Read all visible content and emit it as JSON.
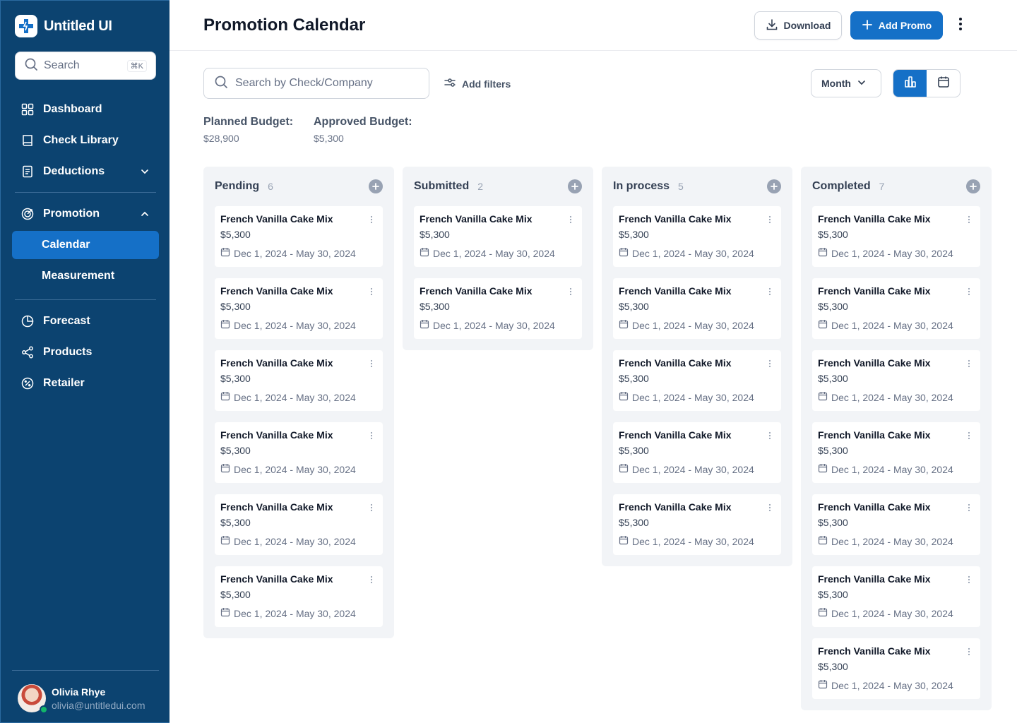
{
  "app": {
    "name": "Untitled UI"
  },
  "sidebar": {
    "search_placeholder": "Search",
    "search_shortcut": "⌘K",
    "items": [
      {
        "label": "Dashboard",
        "icon": "grid-icon"
      },
      {
        "label": "Check Library",
        "icon": "book-icon"
      },
      {
        "label": "Deductions",
        "icon": "receipt-icon"
      },
      {
        "label": "Promotion",
        "icon": "target-icon"
      },
      {
        "label": "Calendar"
      },
      {
        "label": "Measurement"
      },
      {
        "label": "Forecast",
        "icon": "pie-chart-icon"
      },
      {
        "label": "Products",
        "icon": "share-icon"
      },
      {
        "label": "Retailer",
        "icon": "percent-badge-icon"
      }
    ],
    "active_item": "Calendar"
  },
  "user": {
    "name": "Olivia Rhye",
    "email": "olivia@untitledui.com"
  },
  "header": {
    "title": "Promotion Calendar",
    "download_label": "Download",
    "add_label": "Add Promo"
  },
  "toolbar": {
    "search_placeholder": "Search by Check/Company",
    "filters_label": "Add filters",
    "period": "Month"
  },
  "budget": {
    "planned_label": "Planned Budget:",
    "planned_value": "$28,900",
    "approved_label": "Approved Budget:",
    "approved_value": "$5,300"
  },
  "board": {
    "columns": [
      {
        "title": "Pending",
        "count": "6",
        "cards": [
          {
            "title": "French Vanilla Cake Mix",
            "amount": "$5,300",
            "dates": "Dec 1, 2024 - May 30, 2024"
          },
          {
            "title": "French Vanilla Cake Mix",
            "amount": "$5,300",
            "dates": "Dec 1, 2024 - May 30, 2024"
          },
          {
            "title": "French Vanilla Cake Mix",
            "amount": "$5,300",
            "dates": "Dec 1, 2024 - May 30, 2024"
          },
          {
            "title": "French Vanilla Cake Mix",
            "amount": "$5,300",
            "dates": "Dec 1, 2024 - May 30, 2024"
          },
          {
            "title": "French Vanilla Cake Mix",
            "amount": "$5,300",
            "dates": "Dec 1, 2024 - May 30, 2024"
          },
          {
            "title": "French Vanilla Cake Mix",
            "amount": "$5,300",
            "dates": "Dec 1, 2024 - May 30, 2024"
          }
        ]
      },
      {
        "title": "Submitted",
        "count": "2",
        "cards": [
          {
            "title": "French Vanilla Cake Mix",
            "amount": "$5,300",
            "dates": "Dec 1, 2024 - May 30, 2024"
          },
          {
            "title": "French Vanilla Cake Mix",
            "amount": "$5,300",
            "dates": "Dec 1, 2024 - May 30, 2024"
          }
        ]
      },
      {
        "title": "In process",
        "count": "5",
        "cards": [
          {
            "title": "French Vanilla Cake Mix",
            "amount": "$5,300",
            "dates": "Dec 1, 2024 - May 30, 2024"
          },
          {
            "title": "French Vanilla Cake Mix",
            "amount": "$5,300",
            "dates": "Dec 1, 2024 - May 30, 2024"
          },
          {
            "title": "French Vanilla Cake Mix",
            "amount": "$5,300",
            "dates": "Dec 1, 2024 - May 30, 2024"
          },
          {
            "title": "French Vanilla Cake Mix",
            "amount": "$5,300",
            "dates": "Dec 1, 2024 - May 30, 2024"
          },
          {
            "title": "French Vanilla Cake Mix",
            "amount": "$5,300",
            "dates": "Dec 1, 2024 - May 30, 2024"
          }
        ]
      },
      {
        "title": "Completed",
        "count": "7",
        "cards": [
          {
            "title": "French Vanilla Cake Mix",
            "amount": "$5,300",
            "dates": "Dec 1, 2024 - May 30, 2024"
          },
          {
            "title": "French Vanilla Cake Mix",
            "amount": "$5,300",
            "dates": "Dec 1, 2024 - May 30, 2024"
          },
          {
            "title": "French Vanilla Cake Mix",
            "amount": "$5,300",
            "dates": "Dec 1, 2024 - May 30, 2024"
          },
          {
            "title": "French Vanilla Cake Mix",
            "amount": "$5,300",
            "dates": "Dec 1, 2024 - May 30, 2024"
          },
          {
            "title": "French Vanilla Cake Mix",
            "amount": "$5,300",
            "dates": "Dec 1, 2024 - May 30, 2024"
          },
          {
            "title": "French Vanilla Cake Mix",
            "amount": "$5,300",
            "dates": "Dec 1, 2024 - May 30, 2024"
          },
          {
            "title": "French Vanilla Cake Mix",
            "amount": "$5,300",
            "dates": "Dec 1, 2024 - May 30, 2024"
          }
        ]
      }
    ]
  },
  "colors": {
    "sidebar_bg": "#0c4370",
    "accent": "#1570c7",
    "column_bg": "#f2f4f7"
  }
}
